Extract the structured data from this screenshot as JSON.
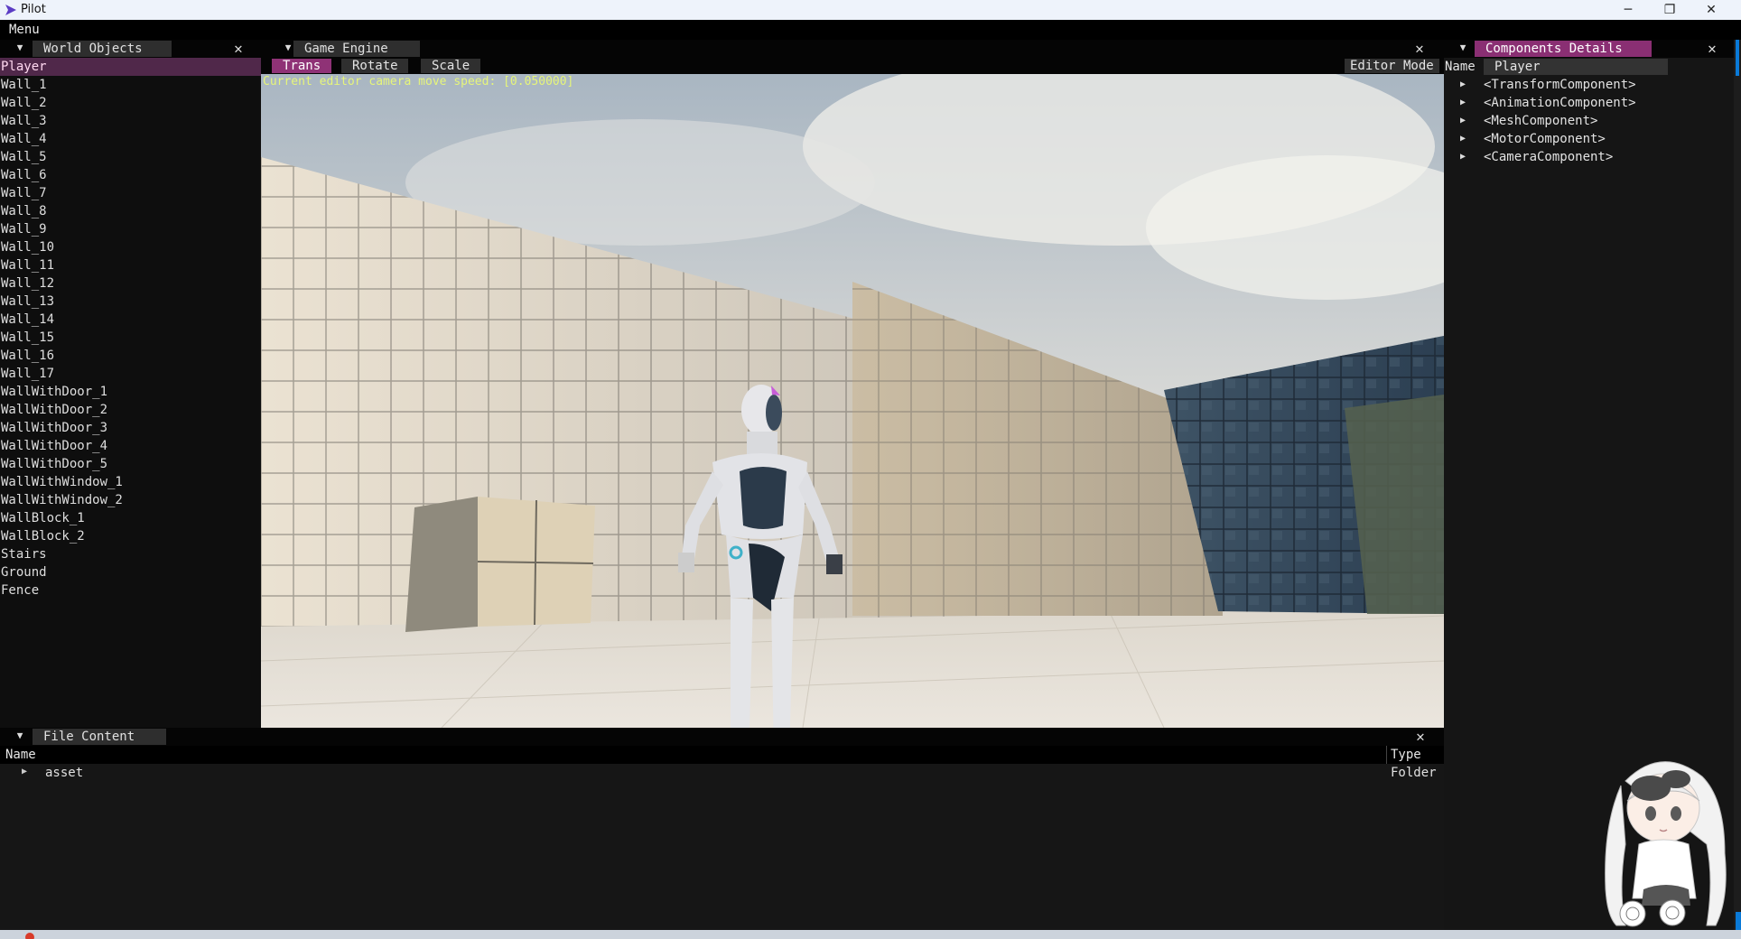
{
  "window": {
    "title": "Pilot",
    "min_glyph": "─",
    "max_glyph": "❐",
    "close_glyph": "✕"
  },
  "menu": {
    "label": "Menu"
  },
  "world_panel": {
    "title": "World Objects",
    "objects": [
      "Player",
      "Wall_1",
      "Wall_2",
      "Wall_3",
      "Wall_4",
      "Wall_5",
      "Wall_6",
      "Wall_7",
      "Wall_8",
      "Wall_9",
      "Wall_10",
      "Wall_11",
      "Wall_12",
      "Wall_13",
      "Wall_14",
      "Wall_15",
      "Wall_16",
      "Wall_17",
      "WallWithDoor_1",
      "WallWithDoor_2",
      "WallWithDoor_3",
      "WallWithDoor_4",
      "WallWithDoor_5",
      "WallWithWindow_1",
      "WallWithWindow_2",
      "WallBlock_1",
      "WallBlock_2",
      "Stairs",
      "Ground",
      "Fence"
    ],
    "selected": "Player"
  },
  "engine_panel": {
    "title": "Game Engine",
    "tools": [
      "Trans",
      "Rotate",
      "Scale"
    ],
    "active_tool": "Trans",
    "editor_mode_label": "Editor Mode",
    "speed_text": "Current editor camera move speed: [0.050000]"
  },
  "components_panel": {
    "title": "Components Details",
    "name_label": "Name",
    "name_value": "Player",
    "components": [
      "<TransformComponent>",
      "<AnimationComponent>",
      "<MeshComponent>",
      "<MotorComponent>",
      "<CameraComponent>"
    ]
  },
  "file_panel": {
    "title": "File Content",
    "col_name": "Name",
    "col_type": "Type",
    "rows": [
      {
        "name": "asset",
        "type": "Folder"
      }
    ]
  },
  "glyphs": {
    "collapse": "▼",
    "close": "✕",
    "tree_arrow": "▶"
  },
  "colors": {
    "accent": "#8a2f73",
    "selected_row": "#50284a",
    "speed_text": "#e6f57a",
    "scroll_thumb": "#0a7ad8"
  }
}
